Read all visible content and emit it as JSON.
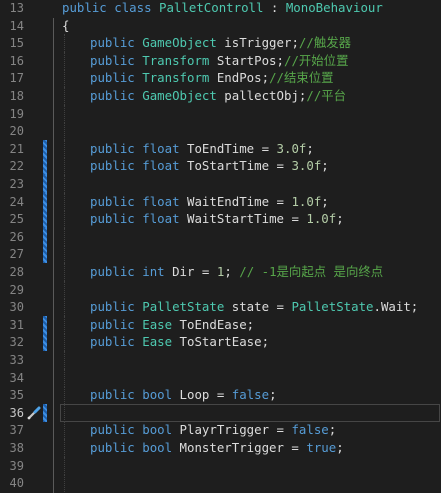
{
  "editor": {
    "lines": [
      {
        "num": "13",
        "tokens": [
          {
            "t": "kw",
            "v": "public"
          },
          {
            "t": "pl",
            "v": " "
          },
          {
            "t": "kw",
            "v": "class"
          },
          {
            "t": "pl",
            "v": " "
          },
          {
            "t": "ty",
            "v": "PalletControll"
          },
          {
            "t": "pl",
            "v": " : "
          },
          {
            "t": "ty",
            "v": "MonoBehaviour"
          }
        ],
        "indent": 0,
        "dx": 0
      },
      {
        "num": "14",
        "tokens": [
          {
            "t": "pl",
            "v": "{"
          }
        ],
        "indent": 0,
        "dx": 0
      },
      {
        "num": "15",
        "tokens": [
          {
            "t": "kw",
            "v": "public"
          },
          {
            "t": "pl",
            "v": " "
          },
          {
            "t": "ty",
            "v": "GameObject"
          },
          {
            "t": "pl",
            "v": " isTrigger;"
          },
          {
            "t": "cm",
            "v": "//触发器"
          }
        ],
        "indent": 1
      },
      {
        "num": "16",
        "tokens": [
          {
            "t": "kw",
            "v": "public"
          },
          {
            "t": "pl",
            "v": " "
          },
          {
            "t": "ty",
            "v": "Transform"
          },
          {
            "t": "pl",
            "v": " StartPos;"
          },
          {
            "t": "cm",
            "v": "//开始位置"
          }
        ],
        "indent": 1
      },
      {
        "num": "17",
        "tokens": [
          {
            "t": "kw",
            "v": "public"
          },
          {
            "t": "pl",
            "v": " "
          },
          {
            "t": "ty",
            "v": "Transform"
          },
          {
            "t": "pl",
            "v": " EndPos;"
          },
          {
            "t": "cm",
            "v": "//结束位置"
          }
        ],
        "indent": 1
      },
      {
        "num": "18",
        "tokens": [
          {
            "t": "kw",
            "v": "public"
          },
          {
            "t": "pl",
            "v": " "
          },
          {
            "t": "ty",
            "v": "GameObject"
          },
          {
            "t": "pl",
            "v": " pallectObj;"
          },
          {
            "t": "cm",
            "v": "//平台"
          }
        ],
        "indent": 1
      },
      {
        "num": "19",
        "tokens": [],
        "indent": 1
      },
      {
        "num": "20",
        "tokens": [],
        "indent": 1
      },
      {
        "num": "21",
        "tokens": [
          {
            "t": "kw",
            "v": "public"
          },
          {
            "t": "pl",
            "v": " "
          },
          {
            "t": "kw",
            "v": "float"
          },
          {
            "t": "pl",
            "v": " ToEndTime = "
          },
          {
            "t": "num",
            "v": "3.0f"
          },
          {
            "t": "pl",
            "v": ";"
          }
        ],
        "indent": 1,
        "mark": true
      },
      {
        "num": "22",
        "tokens": [
          {
            "t": "kw",
            "v": "public"
          },
          {
            "t": "pl",
            "v": " "
          },
          {
            "t": "kw",
            "v": "float"
          },
          {
            "t": "pl",
            "v": " ToStartTime = "
          },
          {
            "t": "num",
            "v": "3.0f"
          },
          {
            "t": "pl",
            "v": ";"
          }
        ],
        "indent": 1,
        "mark": true
      },
      {
        "num": "23",
        "tokens": [],
        "indent": 1,
        "mark": true
      },
      {
        "num": "24",
        "tokens": [
          {
            "t": "kw",
            "v": "public"
          },
          {
            "t": "pl",
            "v": " "
          },
          {
            "t": "kw",
            "v": "float"
          },
          {
            "t": "pl",
            "v": " WaitEndTime = "
          },
          {
            "t": "num",
            "v": "1.0f"
          },
          {
            "t": "pl",
            "v": ";"
          }
        ],
        "indent": 1,
        "mark": true
      },
      {
        "num": "25",
        "tokens": [
          {
            "t": "kw",
            "v": "public"
          },
          {
            "t": "pl",
            "v": " "
          },
          {
            "t": "kw",
            "v": "float"
          },
          {
            "t": "pl",
            "v": " WaitStartTime = "
          },
          {
            "t": "num",
            "v": "1.0f"
          },
          {
            "t": "pl",
            "v": ";"
          }
        ],
        "indent": 1,
        "mark": true
      },
      {
        "num": "26",
        "tokens": [],
        "indent": 1,
        "mark": true
      },
      {
        "num": "27",
        "tokens": [],
        "indent": 1,
        "mark": true
      },
      {
        "num": "28",
        "tokens": [
          {
            "t": "kw",
            "v": "public"
          },
          {
            "t": "pl",
            "v": " "
          },
          {
            "t": "kw",
            "v": "int"
          },
          {
            "t": "pl",
            "v": " Dir = "
          },
          {
            "t": "num",
            "v": "1"
          },
          {
            "t": "pl",
            "v": "; "
          },
          {
            "t": "cm",
            "v": "// -1是向起点 是向终点"
          }
        ],
        "indent": 1
      },
      {
        "num": "29",
        "tokens": [],
        "indent": 1
      },
      {
        "num": "30",
        "tokens": [
          {
            "t": "kw",
            "v": "public"
          },
          {
            "t": "pl",
            "v": " "
          },
          {
            "t": "ty",
            "v": "PalletState"
          },
          {
            "t": "pl",
            "v": " state = "
          },
          {
            "t": "ty",
            "v": "PalletState"
          },
          {
            "t": "pl",
            "v": ".Wait;"
          }
        ],
        "indent": 1
      },
      {
        "num": "31",
        "tokens": [
          {
            "t": "kw",
            "v": "public"
          },
          {
            "t": "pl",
            "v": " "
          },
          {
            "t": "ty",
            "v": "Ease"
          },
          {
            "t": "pl",
            "v": " ToEndEase;"
          }
        ],
        "indent": 1,
        "mark": true
      },
      {
        "num": "32",
        "tokens": [
          {
            "t": "kw",
            "v": "public"
          },
          {
            "t": "pl",
            "v": " "
          },
          {
            "t": "ty",
            "v": "Ease"
          },
          {
            "t": "pl",
            "v": " ToStartEase;"
          }
        ],
        "indent": 1,
        "mark": true
      },
      {
        "num": "33",
        "tokens": [],
        "indent": 1
      },
      {
        "num": "34",
        "tokens": [],
        "indent": 1
      },
      {
        "num": "35",
        "tokens": [
          {
            "t": "kw",
            "v": "public"
          },
          {
            "t": "pl",
            "v": " "
          },
          {
            "t": "kw",
            "v": "bool"
          },
          {
            "t": "pl",
            "v": " Loop = "
          },
          {
            "t": "kw",
            "v": "false"
          },
          {
            "t": "pl",
            "v": ";"
          }
        ],
        "indent": 1
      },
      {
        "num": "36",
        "tokens": [],
        "indent": 1,
        "current": true,
        "mark": true,
        "screwdriver": true
      },
      {
        "num": "37",
        "tokens": [
          {
            "t": "kw",
            "v": "public"
          },
          {
            "t": "pl",
            "v": " "
          },
          {
            "t": "kw",
            "v": "bool"
          },
          {
            "t": "pl",
            "v": " PlayrTrigger = "
          },
          {
            "t": "kw",
            "v": "false"
          },
          {
            "t": "pl",
            "v": ";"
          }
        ],
        "indent": 1
      },
      {
        "num": "38",
        "tokens": [
          {
            "t": "kw",
            "v": "public"
          },
          {
            "t": "pl",
            "v": " "
          },
          {
            "t": "kw",
            "v": "bool"
          },
          {
            "t": "pl",
            "v": " MonsterTrigger = "
          },
          {
            "t": "kw",
            "v": "true"
          },
          {
            "t": "pl",
            "v": ";"
          }
        ],
        "indent": 1
      },
      {
        "num": "39",
        "tokens": [],
        "indent": 1
      },
      {
        "num": "40",
        "tokens": [],
        "indent": 1
      }
    ],
    "icons": {
      "quick_actions": "screwdriver-icon"
    },
    "colors": {
      "background": "#1e1e1e",
      "keyword": "#569cd6",
      "type": "#4ec9b0",
      "number": "#b5cea8",
      "comment": "#57a64a",
      "plain": "#dcdcdc",
      "line_number": "#858585",
      "change_marker": "#1e5ea8"
    }
  }
}
